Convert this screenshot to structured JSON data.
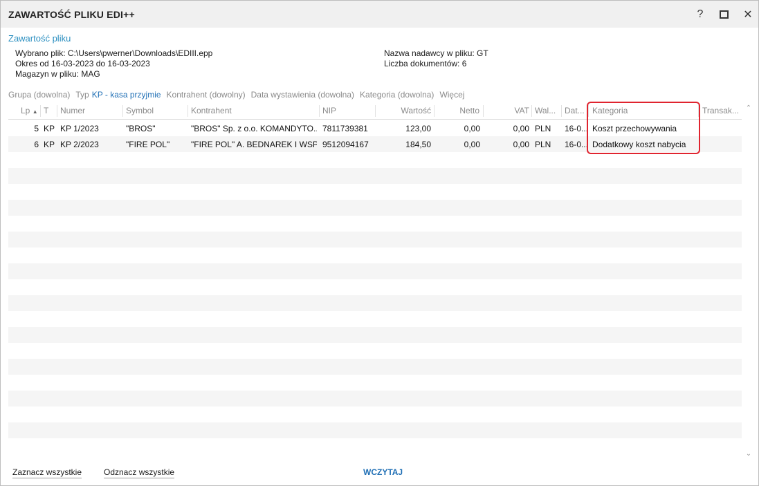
{
  "window": {
    "title": "ZAWARTOŚĆ PLIKU EDI++",
    "help_label": "?",
    "close_label": "✕"
  },
  "section": {
    "title": "Zawartość pliku"
  },
  "info": {
    "file": "Wybrano plik: C:\\Users\\pwerner\\Downloads\\EDIII.epp",
    "period": "Okres od 16-03-2023 do 16-03-2023",
    "warehouse": "Magazyn w pliku: MAG",
    "sender": "Nazwa nadawcy w pliku: GT",
    "doc_count": "Liczba dokumentów: 6"
  },
  "filters": {
    "group": "Grupa (dowolna)",
    "type_label": "Typ",
    "type_value": "KP - kasa przyjmie",
    "contractor": "Kontrahent (dowolny)",
    "issue_date": "Data wystawienia (dowolna)",
    "category": "Kategoria (dowolna)",
    "more": "Więcej"
  },
  "table": {
    "columns": {
      "lp": "Lp",
      "t": "T",
      "numer": "Numer",
      "symbol": "Symbol",
      "kontrahent": "Kontrahent",
      "nip": "NIP",
      "wartosc": "Wartość",
      "netto": "Netto",
      "vat": "VAT",
      "waluta": "Wal...",
      "data": "Dat...",
      "kategoria": "Kategoria",
      "transakcja": "Transak..."
    },
    "sort_indicator": "▲",
    "rows": [
      {
        "lp": "5",
        "t": "KP",
        "numer": "KP 1/2023",
        "symbol": "\"BROS\"",
        "kontrahent": "\"BROS\" Sp. z o.o. KOMANDYTO...",
        "nip": "7811739381",
        "wartosc": "123,00",
        "netto": "0,00",
        "vat": "0,00",
        "waluta": "PLN",
        "data": "16-0...",
        "kategoria": "Koszt przechowywania",
        "transakcja": ""
      },
      {
        "lp": "6",
        "t": "KP",
        "numer": "KP 2/2023",
        "symbol": "\"FIRE POL\"",
        "kontrahent": "\"FIRE POL\" A. BEDNAREK I WSP...",
        "nip": "9512094167",
        "wartosc": "184,50",
        "netto": "0,00",
        "vat": "0,00",
        "waluta": "PLN",
        "data": "16-0...",
        "kategoria": "Dodatkowy koszt nabycia",
        "transakcja": ""
      }
    ]
  },
  "scroll": {
    "up": "⌃",
    "down": "⌄"
  },
  "footer": {
    "select_all": "Zaznacz wszystkie",
    "deselect_all": "Odznacz wszystkie",
    "load": "WCZYTAJ"
  },
  "colors": {
    "accent_blue": "#1f6fb5",
    "link_blue": "#2b8fc0",
    "highlight_red": "#e0242f"
  }
}
